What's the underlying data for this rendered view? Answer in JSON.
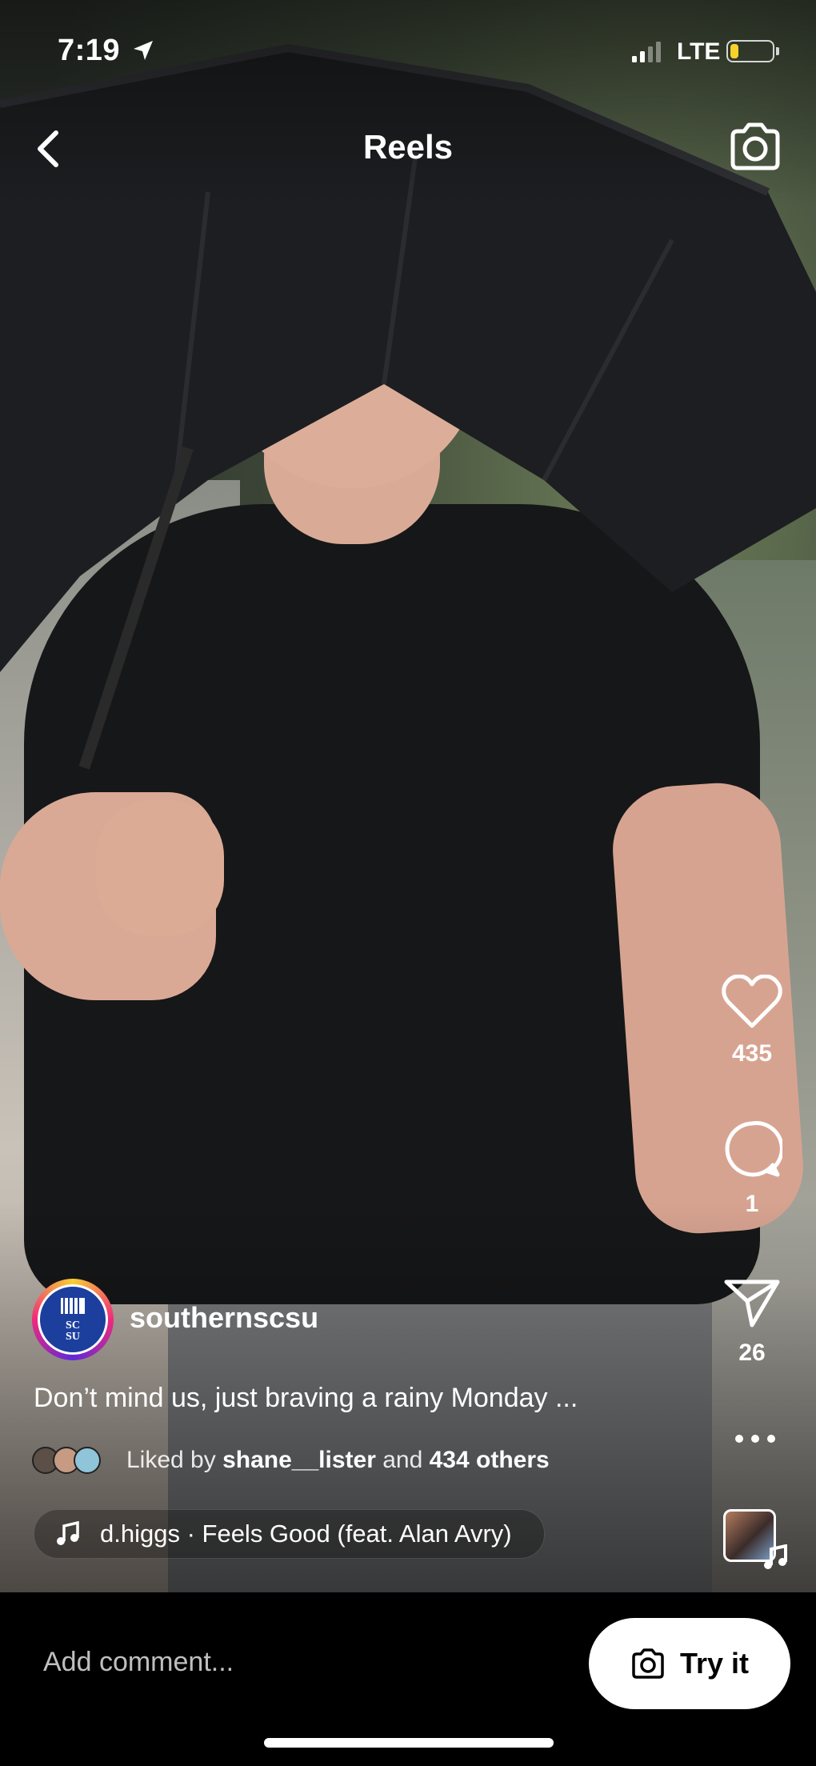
{
  "status_bar": {
    "time": "7:19",
    "network": "LTE",
    "battery_level": 0.2,
    "battery_color": "#f6d22b"
  },
  "header": {
    "title": "Reels"
  },
  "actions": {
    "likes": "435",
    "comments": "1",
    "shares": "26"
  },
  "post": {
    "username": "southernscsu",
    "caption": "Don’t mind us, just braving a rainy Monday ...",
    "liked_prefix": "Liked by",
    "liked_user": "shane__lister",
    "liked_and": "and",
    "liked_others": "434 others",
    "audio": "d.higgs · Feels Good (feat. Alan Avry)",
    "avatar_text": "SC SU"
  },
  "bottom": {
    "comment_placeholder": "Add comment...",
    "try_label": "Try it"
  },
  "icons": [
    "location-arrow-icon",
    "signal-icon",
    "battery-icon",
    "back-chevron-icon",
    "camera-icon",
    "heart-icon",
    "comment-icon",
    "share-icon",
    "more-icon",
    "music-note-icon"
  ]
}
